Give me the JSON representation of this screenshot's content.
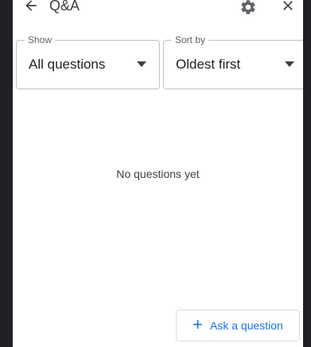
{
  "header": {
    "title": "Q&A",
    "back_icon": "arrow-left-icon",
    "settings_icon": "gear-icon",
    "close_icon": "close-icon"
  },
  "filters": {
    "show": {
      "label": "Show",
      "value": "All questions"
    },
    "sort": {
      "label": "Sort by",
      "value": "Oldest first"
    }
  },
  "empty_state": {
    "text": "No questions yet"
  },
  "ask_button": {
    "icon": "+",
    "label": "Ask a question"
  },
  "colors": {
    "accent": "#1a73e8",
    "background_dark": "#202124",
    "panel": "#ffffff",
    "border": "#bdc1c6"
  }
}
